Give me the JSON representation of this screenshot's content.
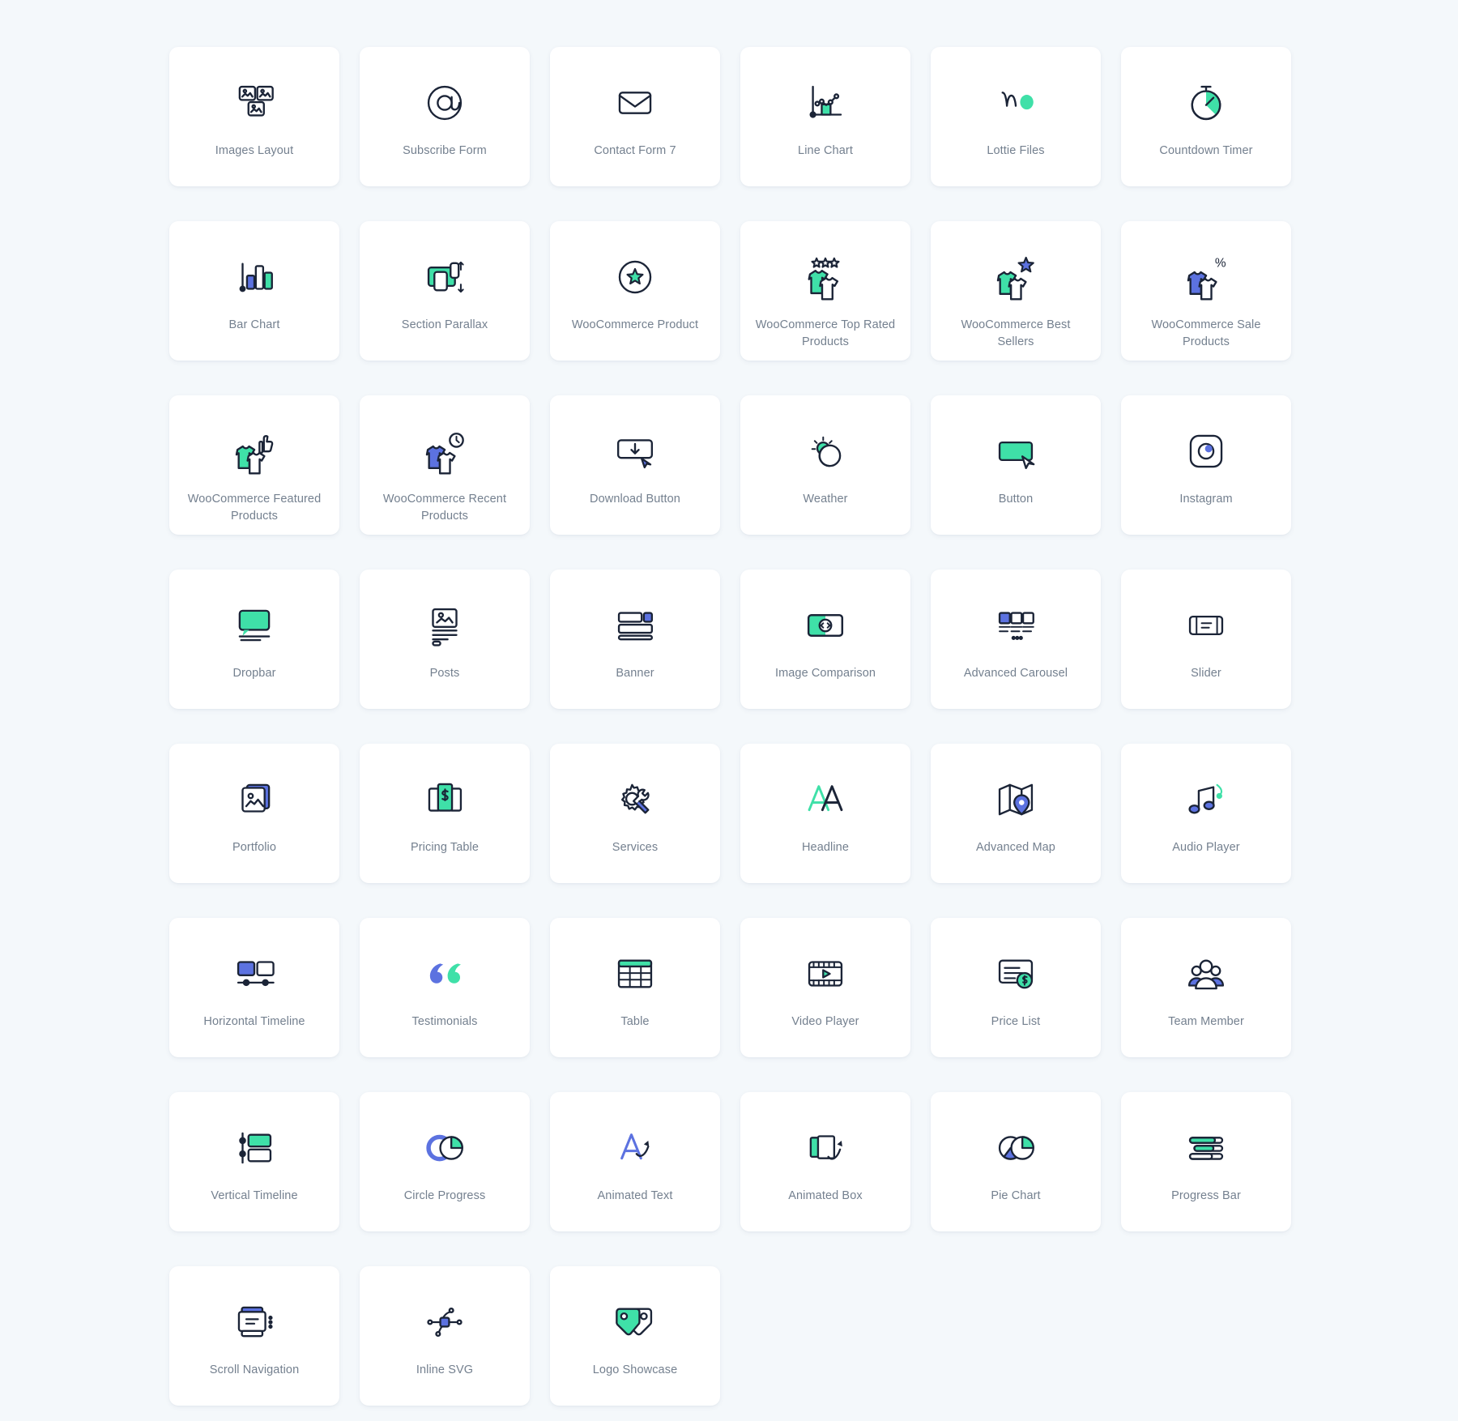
{
  "colors": {
    "page_background": "#f4f8fb",
    "card_background": "#ffffff",
    "label_text": "#74808f",
    "stroke_dark": "#1b2437",
    "accent_green": "#3fe0a8",
    "accent_blue": "#5c72e0"
  },
  "grid": {
    "columns": 6,
    "total_items": 45,
    "items": [
      {
        "label": "Images Layout",
        "icon": "images-layout-icon"
      },
      {
        "label": "Subscribe Form",
        "icon": "at-sign-icon"
      },
      {
        "label": "Contact Form 7",
        "icon": "envelope-icon"
      },
      {
        "label": "Line Chart",
        "icon": "line-chart-icon"
      },
      {
        "label": "Lottie Files",
        "icon": "lottie-files-icon"
      },
      {
        "label": "Countdown Timer",
        "icon": "stopwatch-icon"
      },
      {
        "label": "Bar Chart",
        "icon": "bar-chart-icon"
      },
      {
        "label": "Section Parallax",
        "icon": "section-parallax-icon"
      },
      {
        "label": "WooCommerce Product",
        "icon": "circle-star-icon"
      },
      {
        "label": "WooCommerce Top Rated Products",
        "icon": "shirts-stars-icon"
      },
      {
        "label": "WooCommerce Best Sellers",
        "icon": "shirts-star-icon"
      },
      {
        "label": "WooCommerce Sale Products",
        "icon": "shirts-percent-icon"
      },
      {
        "label": "WooCommerce Featured Products",
        "icon": "shirts-thumbsup-icon"
      },
      {
        "label": "WooCommerce Recent Products",
        "icon": "shirts-clock-icon"
      },
      {
        "label": "Download Button",
        "icon": "download-button-icon"
      },
      {
        "label": "Weather",
        "icon": "weather-icon"
      },
      {
        "label": "Button",
        "icon": "button-cursor-icon"
      },
      {
        "label": "Instagram",
        "icon": "instagram-icon"
      },
      {
        "label": "Dropbar",
        "icon": "dropbar-icon"
      },
      {
        "label": "Posts",
        "icon": "posts-icon"
      },
      {
        "label": "Banner",
        "icon": "banner-icon"
      },
      {
        "label": "Image Comparison",
        "icon": "image-comparison-icon"
      },
      {
        "label": "Advanced Carousel",
        "icon": "advanced-carousel-icon"
      },
      {
        "label": "Slider",
        "icon": "slider-icon"
      },
      {
        "label": "Portfolio",
        "icon": "portfolio-icon"
      },
      {
        "label": "Pricing Table",
        "icon": "pricing-table-icon"
      },
      {
        "label": "Services",
        "icon": "gear-wrench-icon"
      },
      {
        "label": "Headline",
        "icon": "headline-aa-icon"
      },
      {
        "label": "Advanced Map",
        "icon": "map-pin-icon"
      },
      {
        "label": "Audio Player",
        "icon": "music-notes-icon"
      },
      {
        "label": "Horizontal Timeline",
        "icon": "horizontal-timeline-icon"
      },
      {
        "label": "Testimonials",
        "icon": "quote-marks-icon"
      },
      {
        "label": "Table",
        "icon": "table-icon"
      },
      {
        "label": "Video Player",
        "icon": "film-play-icon"
      },
      {
        "label": "Price List",
        "icon": "price-list-icon"
      },
      {
        "label": "Team Member",
        "icon": "team-member-icon"
      },
      {
        "label": "Vertical Timeline",
        "icon": "vertical-timeline-icon"
      },
      {
        "label": "Circle Progress",
        "icon": "circle-progress-icon"
      },
      {
        "label": "Animated Text",
        "icon": "animated-text-icon"
      },
      {
        "label": "Animated Box",
        "icon": "animated-box-icon"
      },
      {
        "label": "Pie Chart",
        "icon": "pie-chart-icon"
      },
      {
        "label": "Progress Bar",
        "icon": "progress-bar-icon"
      },
      {
        "label": "Scroll Navigation",
        "icon": "scroll-navigation-icon"
      },
      {
        "label": "Inline SVG",
        "icon": "inline-svg-icon"
      },
      {
        "label": "Logo Showcase",
        "icon": "logo-showcase-icon"
      }
    ]
  }
}
